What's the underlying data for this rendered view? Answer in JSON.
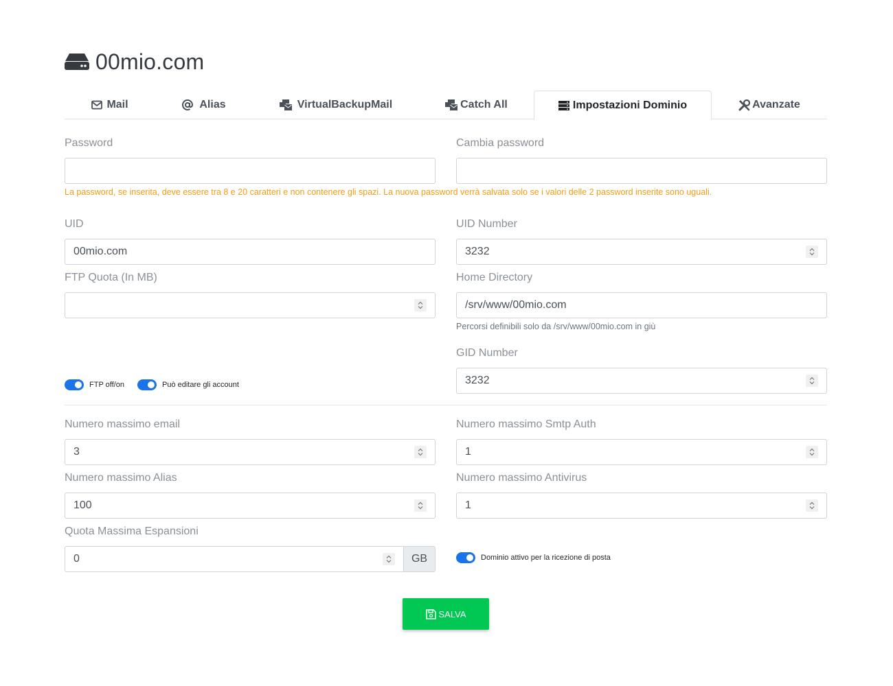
{
  "header": {
    "title": "00mio.com",
    "icon": "hard-drive-icon"
  },
  "tabs": [
    {
      "label": "Mail",
      "icon": "envelope-icon"
    },
    {
      "label": "Alias",
      "icon": "at-icon"
    },
    {
      "label": "VirtualBackupMail",
      "icon": "mail-bulk-icon"
    },
    {
      "label": "Catch All",
      "icon": "mail-bulk-icon"
    },
    {
      "label": "Impostazioni Dominio",
      "icon": "server-icon",
      "active": true
    },
    {
      "label": "Avanzate",
      "icon": "tools-icon"
    }
  ],
  "form": {
    "password": {
      "label": "Password",
      "value": ""
    },
    "change_password": {
      "label": "Cambia password",
      "value": ""
    },
    "password_hint": "La password, se inserita, deve essere tra 8 e 20 caratteri e non contenere gli spazi. La nuova password verrà salvata solo se i valori delle 2 password inserite sono uguali.",
    "uid": {
      "label": "UID",
      "value": "00mio.com"
    },
    "uid_number": {
      "label": "UID Number",
      "value": "3232"
    },
    "ftp_quota": {
      "label": "FTP Quota (In MB)",
      "value": ""
    },
    "home_directory": {
      "label": "Home Directory",
      "value": "/srv/www/00mio.com",
      "hint": "Percorsi definibili solo da /srv/www/00mio.com in giù"
    },
    "gid_number": {
      "label": "GID Number",
      "value": "3232"
    },
    "ftp_toggle": {
      "label": "FTP off/on",
      "on": true
    },
    "edit_accounts_toggle": {
      "label": "Può editare gli account",
      "on": true
    },
    "max_email": {
      "label": "Numero massimo email",
      "value": "3"
    },
    "max_smtp_auth": {
      "label": "Numero massimo Smtp Auth",
      "value": "1"
    },
    "max_alias": {
      "label": "Numero massimo Alias",
      "value": "100"
    },
    "max_antivirus": {
      "label": "Numero massimo Antivirus",
      "value": "1"
    },
    "max_expansion_quota": {
      "label": "Quota Massima Espansioni",
      "value": "0",
      "unit": "GB"
    },
    "domain_active_toggle": {
      "label": "Dominio attivo per la ricezione di posta",
      "on": true
    }
  },
  "save_button": {
    "label": "SALVA",
    "icon": "save-icon"
  },
  "colors": {
    "accent": "#1a73e8",
    "save": "#00c853",
    "warning": "#f39c12"
  }
}
